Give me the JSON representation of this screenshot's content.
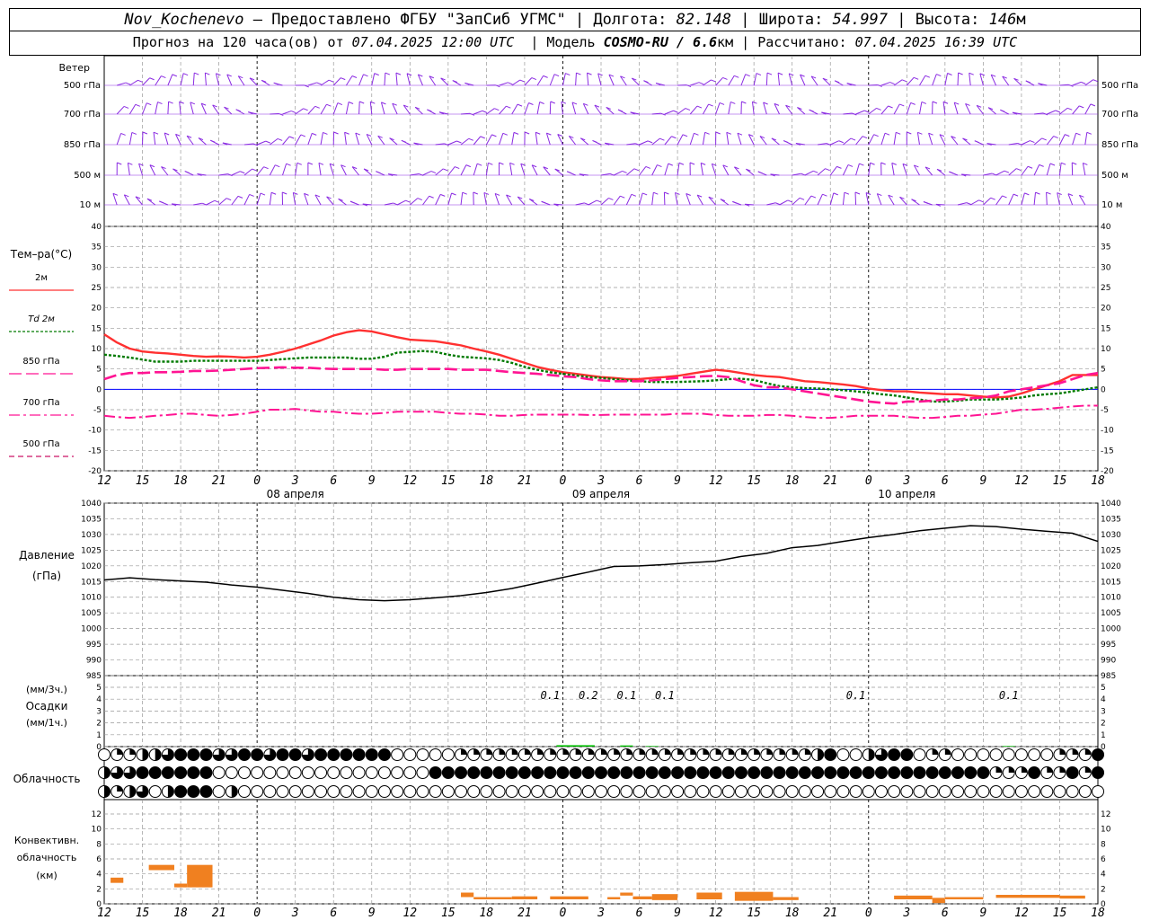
{
  "header": {
    "station": "Nov_Kochenevo",
    "dash": "–",
    "provider": "Предоставлено ФГБУ \"ЗапСиб УГМС\"",
    "lon_label": "Долгота:",
    "lon": "82.148",
    "lat_label": "Широта:",
    "lat": "54.997",
    "alt_label": "Высота:",
    "alt": "146",
    "alt_unit": "м",
    "forecast_label": "Прогноз на 120 часа(ов) от",
    "forecast_time": "07.04.2025 12:00 UTC",
    "model_label": "Модель",
    "model": "COSMO-RU / 6.6",
    "model_unit": "км",
    "calc_label": "Рассчитано:",
    "calc_time": "07.04.2025 16:39 UTC"
  },
  "colors": {
    "wind": "#8a2be2",
    "t2m": "#ff3030",
    "td2m": "#007a00",
    "t850": "#ff1493",
    "t700": "#ff1493",
    "t500": "#cc1466",
    "zero": "#0000ff",
    "precip": "#00c000",
    "convective": "#f08020",
    "grid": "#999999"
  },
  "wind": {
    "title": "Ветер",
    "levels": [
      "500 гПа",
      "700 гПа",
      "850 гПа",
      "500 м",
      "10 м"
    ]
  },
  "temperature": {
    "title": "Тем–ра(°C)",
    "legend": [
      "2м",
      "Td 2м",
      "850 гПа",
      "700 гПа",
      "500 гПа"
    ],
    "yticks": [
      -20,
      -15,
      -10,
      -5,
      0,
      5,
      10,
      15,
      20,
      25,
      30,
      35,
      40
    ]
  },
  "pressure": {
    "title1": "Давление",
    "title2": "(гПа)",
    "yticks": [
      985,
      990,
      995,
      1000,
      1005,
      1010,
      1015,
      1020,
      1025,
      1030,
      1035,
      1040
    ]
  },
  "precip": {
    "label1": "(мм/3ч.)",
    "label2": "Осадки",
    "label3": "(мм/1ч.)",
    "yticks": [
      0,
      1,
      2,
      3,
      4,
      5
    ]
  },
  "cloud": {
    "title": "Облачность"
  },
  "convective": {
    "title1": "Конвективн.",
    "title2": "облачность",
    "title3": "(км)",
    "yticks": [
      0,
      2,
      4,
      6,
      8,
      10,
      12
    ]
  },
  "axis": {
    "xticks": [
      "12",
      "15",
      "18",
      "21",
      "0",
      "3",
      "6",
      "9",
      "12",
      "15",
      "18",
      "21",
      "0",
      "3",
      "6",
      "9",
      "12",
      "15",
      "18",
      "21",
      "0",
      "3",
      "6",
      "9",
      "12",
      "15",
      "18"
    ],
    "dates": [
      {
        "label": "08 апреля",
        "hour": 15
      },
      {
        "label": "09 апреля",
        "hour": 39
      },
      {
        "label": "10 апреля",
        "hour": 63
      }
    ]
  },
  "chart_data": [
    {
      "type": "line",
      "title": "",
      "ylabel": "Тем–ра(°C)",
      "ylim": [
        -20,
        40
      ],
      "x_hours": [
        0,
        1,
        2,
        3,
        4,
        5,
        6,
        7,
        8,
        9,
        10,
        11,
        12,
        13,
        14,
        15,
        16,
        17,
        18,
        19,
        20,
        21,
        22,
        23,
        24,
        25,
        26,
        27,
        28,
        29,
        30,
        31,
        32,
        33,
        34,
        35,
        36,
        37,
        38,
        39,
        40,
        41,
        42,
        43,
        44,
        45,
        46,
        47,
        48,
        49,
        50,
        51,
        52,
        53,
        54,
        55,
        56,
        57,
        58,
        59,
        60,
        61,
        62,
        63,
        64,
        65,
        66,
        67,
        68,
        69,
        70,
        71,
        72,
        73,
        74,
        75,
        76,
        77,
        78
      ],
      "series": [
        {
          "name": "2м",
          "values": [
            13.5,
            11.5,
            10,
            9.3,
            9,
            8.8,
            8.5,
            8.2,
            8,
            8.1,
            8,
            7.8,
            8,
            8.5,
            9.2,
            10,
            11,
            12,
            13.2,
            14,
            14.5,
            14.2,
            13.5,
            12.8,
            12.2,
            12,
            11.8,
            11.3,
            10.8,
            10,
            9.3,
            8.5,
            7.5,
            6.5,
            5.5,
            4.8,
            4.2,
            3.8,
            3.4,
            3,
            2.8,
            2.5,
            2.5,
            2.8,
            3,
            3.3,
            3.8,
            4.3,
            4.8,
            4.5,
            4,
            3.5,
            3.2,
            3,
            2.5,
            2,
            1.8,
            1.5,
            1.2,
            0.8,
            0.2,
            -0.2,
            -0.5,
            -0.5,
            -0.8,
            -1,
            -1.2,
            -1.2,
            -1.5,
            -1.8,
            -2,
            -1.8,
            -1,
            0,
            1,
            2,
            3.5,
            3.5,
            3.5
          ]
        },
        {
          "name": "Td 2м",
          "values": [
            8.5,
            8.2,
            7.8,
            7.3,
            6.8,
            6.8,
            6.8,
            7,
            7,
            7,
            7,
            7,
            7,
            7.2,
            7.4,
            7.6,
            7.8,
            7.8,
            7.8,
            7.8,
            7.5,
            7.5,
            8,
            9,
            9.2,
            9.4,
            9.2,
            8.5,
            8,
            7.8,
            7.6,
            7.2,
            6.5,
            5.5,
            4.8,
            4.2,
            3.8,
            3.4,
            3,
            2.8,
            2.5,
            2.2,
            2,
            1.8,
            1.8,
            1.8,
            1.9,
            2,
            2.2,
            2.5,
            2.6,
            2.3,
            1.5,
            0.8,
            0.5,
            0.3,
            0.2,
            0,
            -0.2,
            -0.5,
            -0.8,
            -1.2,
            -1.5,
            -2,
            -2.5,
            -3,
            -3,
            -2.8,
            -2.5,
            -2.5,
            -2.5,
            -2.3,
            -2,
            -1.5,
            -1.2,
            -1,
            -0.5,
            0,
            0.5
          ]
        },
        {
          "name": "850 гПа",
          "values": [
            2.5,
            3.5,
            4,
            4,
            4.2,
            4.2,
            4.3,
            4.5,
            4.5,
            4.6,
            4.8,
            5,
            5.2,
            5.3,
            5.4,
            5.3,
            5.3,
            5.1,
            5,
            5,
            5,
            5,
            4.8,
            4.8,
            5,
            5,
            5,
            5,
            4.8,
            4.8,
            4.8,
            4.5,
            4.2,
            4,
            3.8,
            3.5,
            3.2,
            3,
            2.5,
            2.2,
            2,
            2,
            2,
            2.2,
            2.5,
            2.8,
            3,
            3.2,
            3.3,
            3,
            2,
            1,
            0.5,
            0.5,
            0,
            -0.5,
            -1,
            -1.5,
            -2,
            -2.5,
            -3,
            -3.3,
            -3.5,
            -3,
            -3,
            -2.8,
            -2.5,
            -2.5,
            -2.2,
            -2,
            -1.5,
            -0.5,
            0,
            0.5,
            1,
            1.5,
            2.5,
            3.5,
            4
          ]
        },
        {
          "name": "700 гПа",
          "values": [
            -6.5,
            -6.8,
            -7,
            -6.8,
            -6.5,
            -6.3,
            -6,
            -6,
            -6.3,
            -6.5,
            -6.3,
            -6,
            -5.5,
            -5,
            -5,
            -4.8,
            -5.2,
            -5.5,
            -5.5,
            -5.8,
            -6,
            -6,
            -5.8,
            -5.5,
            -5.5,
            -5.5,
            -5.5,
            -5.8,
            -6,
            -6,
            -6.2,
            -6.5,
            -6.5,
            -6.3,
            -6.2,
            -6.2,
            -6.2,
            -6.2,
            -6.3,
            -6.3,
            -6.2,
            -6.2,
            -6.2,
            -6.2,
            -6.2,
            -6,
            -6,
            -6,
            -6.3,
            -6.5,
            -6.5,
            -6.5,
            -6.3,
            -6.3,
            -6.5,
            -6.8,
            -7,
            -7,
            -6.8,
            -6.5,
            -6.5,
            -6.5,
            -6.5,
            -6.8,
            -7,
            -7,
            -6.8,
            -6.5,
            -6.5,
            -6.2,
            -6,
            -5.5,
            -5,
            -5,
            -4.8,
            -4.5,
            -4.2,
            -4,
            -4
          ]
        },
        {
          "name": "500 гПа",
          "values": []
        }
      ]
    },
    {
      "type": "line",
      "title": "",
      "ylabel": "Давление (гПа)",
      "ylim": [
        985,
        1040
      ],
      "x_hours": [
        0,
        2,
        4,
        6,
        8,
        10,
        12,
        14,
        16,
        18,
        20,
        22,
        24,
        26,
        28,
        30,
        32,
        34,
        36,
        38,
        40,
        42,
        44,
        46,
        48,
        50,
        52,
        54,
        56,
        58,
        60,
        62,
        64,
        66,
        68,
        70,
        72,
        74,
        76,
        78
      ],
      "series": [
        {
          "name": "Давление",
          "values": [
            1015.5,
            1016.2,
            1015.6,
            1015.2,
            1014.8,
            1013.9,
            1013.2,
            1012.2,
            1011.2,
            1010,
            1009.2,
            1008.9,
            1009.2,
            1009.8,
            1010.5,
            1011.5,
            1012.8,
            1014.5,
            1016.3,
            1018,
            1019.8,
            1020,
            1020.4,
            1021,
            1021.5,
            1023,
            1024,
            1025.8,
            1026.5,
            1027.8,
            1029,
            1030,
            1031.2,
            1032,
            1032.8,
            1032.5,
            1031.7,
            1031,
            1030.4,
            1027.8
          ]
        }
      ]
    },
    {
      "type": "bar",
      "title": "",
      "ylabel": "Осадки (мм/3ч.)",
      "ylim": [
        0,
        5
      ],
      "labels": [
        {
          "hour": 35,
          "text": "0.1"
        },
        {
          "hour": 38,
          "text": "0.2"
        },
        {
          "hour": 41,
          "text": "0.1"
        },
        {
          "hour": 44,
          "text": "0.1"
        },
        {
          "hour": 59,
          "text": "0.1"
        },
        {
          "hour": 71,
          "text": "0.1"
        }
      ],
      "bars": [
        {
          "start": 35.5,
          "end": 38.5,
          "value": 0.12
        },
        {
          "start": 40.5,
          "end": 41.5,
          "value": 0.1
        },
        {
          "start": 42.5,
          "end": 43.5,
          "value": 0.05
        },
        {
          "start": 70.5,
          "end": 71.5,
          "value": 0.05
        }
      ]
    },
    {
      "type": "bar",
      "title": "",
      "ylabel": "Конвективн. облачность (км)",
      "ylim": [
        0,
        13
      ],
      "bars": [
        {
          "start": 0.5,
          "end": 1.5,
          "top": 3.5,
          "bottom": 2.8
        },
        {
          "start": 3.5,
          "end": 5.5,
          "top": 5.2,
          "bottom": 4.5
        },
        {
          "start": 5.5,
          "end": 6.5,
          "top": 2.7,
          "bottom": 2.2
        },
        {
          "start": 6.5,
          "end": 8.5,
          "top": 5.2,
          "bottom": 2.2
        },
        {
          "start": 28,
          "end": 29,
          "top": 1.5,
          "bottom": 0.9
        },
        {
          "start": 29,
          "end": 32,
          "top": 0.9,
          "bottom": 0.6
        },
        {
          "start": 32,
          "end": 34,
          "top": 1.0,
          "bottom": 0.6
        },
        {
          "start": 35,
          "end": 38,
          "top": 1.0,
          "bottom": 0.6
        },
        {
          "start": 39.5,
          "end": 40.5,
          "top": 0.9,
          "bottom": 0.6
        },
        {
          "start": 40.5,
          "end": 41.5,
          "top": 1.5,
          "bottom": 1.1
        },
        {
          "start": 41.5,
          "end": 43,
          "top": 1.0,
          "bottom": 0.6
        },
        {
          "start": 43,
          "end": 45,
          "top": 1.3,
          "bottom": 0.5
        },
        {
          "start": 46.5,
          "end": 48.5,
          "top": 1.5,
          "bottom": 0.6
        },
        {
          "start": 49.5,
          "end": 52.5,
          "top": 1.6,
          "bottom": 0.4
        },
        {
          "start": 52.5,
          "end": 54.5,
          "top": 0.9,
          "bottom": 0.5
        },
        {
          "start": 62,
          "end": 65,
          "top": 1.1,
          "bottom": 0.6
        },
        {
          "start": 65,
          "end": 66,
          "top": 0.8,
          "bottom": 0.1
        },
        {
          "start": 66,
          "end": 69,
          "top": 0.9,
          "bottom": 0.6
        },
        {
          "start": 70,
          "end": 75,
          "top": 1.2,
          "bottom": 0.8
        },
        {
          "start": 75,
          "end": 77,
          "top": 1.1,
          "bottom": 0.7
        }
      ]
    },
    {
      "type": "table",
      "title": "",
      "rows": [
        "011223444334434434444440000011111111111111111111111111112400234401100000000111440",
        "233444444000000000000000004444444444444444444444444444444444444444444411141141444",
        "212302444020000000000000000000000000000000000000000000000000000000000000000000000"
      ]
    },
    {
      "type": "table",
      "title": "",
      "rows": []
    }
  ]
}
